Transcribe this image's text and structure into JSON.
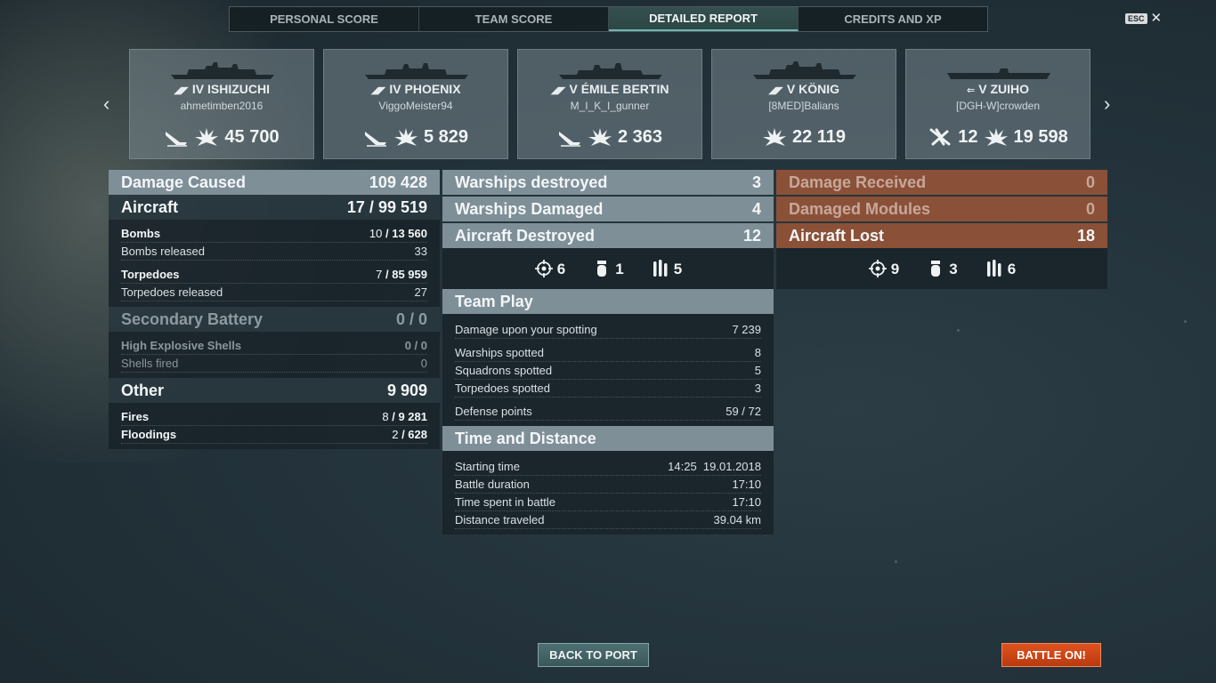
{
  "tabs": [
    {
      "label": "PERSONAL SCORE"
    },
    {
      "label": "TEAM SCORE"
    },
    {
      "label": "DETAILED REPORT"
    },
    {
      "label": "CREDITS AND XP"
    }
  ],
  "esc": {
    "key": "ESC",
    "close": "✕"
  },
  "nav": {
    "prev": "‹",
    "next": "›"
  },
  "ships": [
    {
      "tier": "IV",
      "name": "ISHIZUCHI",
      "player": "ahmetimben2016",
      "icon1": "sunk-ship-icon",
      "damage": "45 700"
    },
    {
      "tier": "IV",
      "name": "PHOENIX",
      "player": "ViggoMeister94",
      "icon1": "sunk-ship-icon",
      "damage": "5 829"
    },
    {
      "tier": "V",
      "name": "ÉMILE BERTIN",
      "player": "M_I_K_I_gunner",
      "icon1": "sunk-ship-icon",
      "damage": "2 363"
    },
    {
      "tier": "V",
      "name": "KÖNIG",
      "player": "[8MED]Balians",
      "icon1": "",
      "damage": "22 119"
    },
    {
      "tier": "V",
      "name": "ZUIHO",
      "player": "[DGH-W]crowden",
      "planes": "12",
      "damage": "19 598"
    }
  ],
  "damage_caused": {
    "title": "Damage Caused",
    "value": "109 428",
    "aircraft": {
      "label": "Aircraft",
      "hits": "17",
      "value": "99 519"
    },
    "bombs": {
      "label": "Bombs",
      "hits": "10",
      "value": "13 560"
    },
    "bombs_released": {
      "label": "Bombs released",
      "value": "33"
    },
    "torpedoes": {
      "label": "Torpedoes",
      "hits": "7",
      "value": "85 959"
    },
    "torpedoes_released": {
      "label": "Torpedoes released",
      "value": "27"
    },
    "secondary": {
      "label": "Secondary Battery",
      "value": "0 / 0"
    },
    "he_shells": {
      "label": "High Explosive Shells",
      "value": "0 / 0"
    },
    "shells_fired": {
      "label": "Shells fired",
      "value": "0"
    },
    "other": {
      "label": "Other",
      "value": "9 909"
    },
    "fires": {
      "label": "Fires",
      "hits": "8",
      "value": "9 281"
    },
    "floodings": {
      "label": "Floodings",
      "hits": "2",
      "value": "628"
    }
  },
  "kills": {
    "warships_destroyed": {
      "label": "Warships destroyed",
      "value": "3"
    },
    "warships_damaged": {
      "label": "Warships Damaged",
      "value": "4"
    },
    "aircraft_destroyed": {
      "label": "Aircraft Destroyed",
      "value": "12"
    },
    "ammo": [
      {
        "icon": "fighter-target-icon",
        "value": "6"
      },
      {
        "icon": "bomb-icon",
        "value": "1"
      },
      {
        "icon": "torpedo-icon",
        "value": "5"
      }
    ]
  },
  "team_play": {
    "title": "Team Play",
    "damage_spotting": {
      "label": "Damage upon your spotting",
      "value": "7 239"
    },
    "warships_spotted": {
      "label": "Warships spotted",
      "value": "8"
    },
    "squadrons_spotted": {
      "label": "Squadrons spotted",
      "value": "5"
    },
    "torpedoes_spotted": {
      "label": "Torpedoes spotted",
      "value": "3"
    },
    "defense_points": {
      "label": "Defense points",
      "value": "59 / 72"
    }
  },
  "time_distance": {
    "title": "Time and Distance",
    "starting_time": {
      "label": "Starting time",
      "value": "14:25  19.01.2018"
    },
    "battle_duration": {
      "label": "Battle duration",
      "value": "17:10"
    },
    "time_in_battle": {
      "label": "Time spent in battle",
      "value": "17:10"
    },
    "distance": {
      "label": "Distance traveled",
      "value": "39.04 km"
    }
  },
  "received": {
    "damage_received": {
      "label": "Damage Received",
      "value": "0"
    },
    "damaged_modules": {
      "label": "Damaged Modules",
      "value": "0"
    },
    "aircraft_lost": {
      "label": "Aircraft Lost",
      "value": "18"
    },
    "ammo": [
      {
        "icon": "fighter-target-icon",
        "value": "9"
      },
      {
        "icon": "bomb-icon",
        "value": "3"
      },
      {
        "icon": "torpedo-icon",
        "value": "6"
      }
    ]
  },
  "buttons": {
    "back_to_port": "BACK TO PORT",
    "battle_on": "BATTLE ON!"
  },
  "colors": {
    "accent_teal": "#6fb7b3",
    "battle_orange": "#d4461a",
    "received_brown": "#8a5138"
  }
}
